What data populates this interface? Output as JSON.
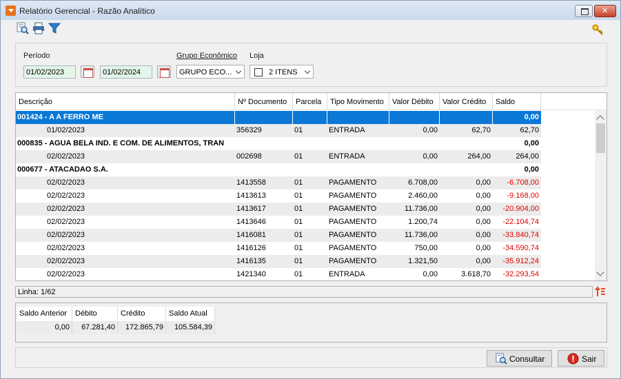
{
  "window": {
    "title": "Relatório Gerencial - Razão Analítico"
  },
  "filters": {
    "periodo_label": "Período",
    "date_from": "01/02/2023",
    "date_to": "01/02/2024",
    "grupo_label": "Grupo Econômico",
    "grupo_value": "GRUPO ECO...",
    "loja_label": "Loja",
    "loja_value": "2 ITENS"
  },
  "grid": {
    "columns": [
      "Descrição",
      "Nº Documento",
      "Parcela",
      "Tipo Movimento",
      "Valor Débito",
      "Valor Crédito",
      "Saldo"
    ],
    "rows": [
      {
        "kind": "group",
        "desc": "001424 - A A FERRO ME",
        "saldo": "0,00"
      },
      {
        "kind": "item",
        "data": "01/02/2023",
        "doc": "356329",
        "parcela": "01",
        "tipo": "ENTRADA",
        "debito": "0,00",
        "credito": "62,70",
        "saldo": "62,70"
      },
      {
        "kind": "group",
        "desc": "000835 - AGUA BELA IND. E COM. DE ALIMENTOS, TRAN",
        "saldo": "0,00"
      },
      {
        "kind": "item",
        "data": "02/02/2023",
        "doc": "002698",
        "parcela": "01",
        "tipo": "ENTRADA",
        "debito": "0,00",
        "credito": "264,00",
        "saldo": "264,00"
      },
      {
        "kind": "group",
        "desc": "000677 - ATACADAO S.A.",
        "saldo": "0,00"
      },
      {
        "kind": "item",
        "data": "02/02/2023",
        "doc": "1413558",
        "parcela": "01",
        "tipo": "PAGAMENTO",
        "debito": "6.708,00",
        "credito": "0,00",
        "saldo": "-6.708,00"
      },
      {
        "kind": "item",
        "data": "02/02/2023",
        "doc": "1413613",
        "parcela": "01",
        "tipo": "PAGAMENTO",
        "debito": "2.460,00",
        "credito": "0,00",
        "saldo": "-9.168,00"
      },
      {
        "kind": "item",
        "data": "02/02/2023",
        "doc": "1413617",
        "parcela": "01",
        "tipo": "PAGAMENTO",
        "debito": "11.736,00",
        "credito": "0,00",
        "saldo": "-20.904,00"
      },
      {
        "kind": "item",
        "data": "02/02/2023",
        "doc": "1413646",
        "parcela": "01",
        "tipo": "PAGAMENTO",
        "debito": "1.200,74",
        "credito": "0,00",
        "saldo": "-22.104,74"
      },
      {
        "kind": "item",
        "data": "02/02/2023",
        "doc": "1416081",
        "parcela": "01",
        "tipo": "PAGAMENTO",
        "debito": "11.736,00",
        "credito": "0,00",
        "saldo": "-33.840,74"
      },
      {
        "kind": "item",
        "data": "02/02/2023",
        "doc": "1416126",
        "parcela": "01",
        "tipo": "PAGAMENTO",
        "debito": "750,00",
        "credito": "0,00",
        "saldo": "-34.590,74"
      },
      {
        "kind": "item",
        "data": "02/02/2023",
        "doc": "1416135",
        "parcela": "01",
        "tipo": "PAGAMENTO",
        "debito": "1.321,50",
        "credito": "0,00",
        "saldo": "-35.912,24"
      },
      {
        "kind": "item",
        "data": "02/02/2023",
        "doc": "1421340",
        "parcela": "01",
        "tipo": "ENTRADA",
        "debito": "0,00",
        "credito": "3.618,70",
        "saldo": "-32.293,54"
      }
    ]
  },
  "status": {
    "linha": "Linha: 1/62"
  },
  "summary": {
    "columns": [
      "Saldo Anterior",
      "Débito",
      "Crédito",
      "Saldo Atual"
    ],
    "values": [
      "0,00",
      "67.281,40",
      "172.865,79",
      "105.584,39"
    ]
  },
  "buttons": {
    "consultar": "Consultar",
    "sair": "Sair"
  },
  "colors": {
    "selection": "#0b78d6",
    "negative": "#e00000",
    "date_bg": "#e3f5e9",
    "accent_orange": "#e8731a"
  }
}
